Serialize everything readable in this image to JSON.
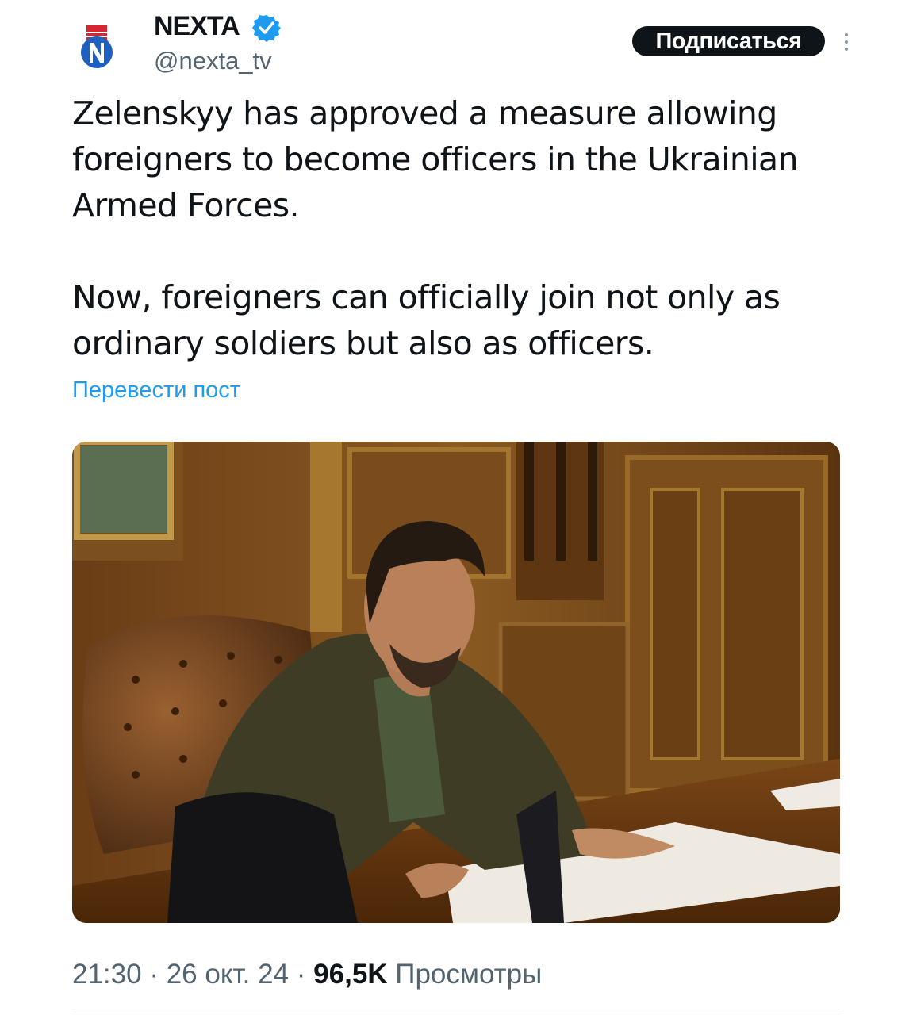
{
  "author": {
    "name": "NEXTA",
    "handle": "@nexta_tv",
    "verified": true,
    "avatar_icon": "nexta-logo-icon"
  },
  "actions": {
    "subscribe_label": "Подписаться",
    "more_icon": "more-vertical-icon"
  },
  "tweet": {
    "text": "Zelenskyy has approved a measure allowing\nforeigners to become officers in the Ukrainian\nArmed Forces.\n\nNow, foreigners can officially join not only as\nordinary soldiers but also as officers.",
    "translate_label": "Перевести пост"
  },
  "media": {
    "type": "photo"
  },
  "meta": {
    "time": "21:30",
    "separator": " · ",
    "date": "26 окт. 24",
    "views_count": "96,5K",
    "views_label": " Просмотры"
  },
  "colors": {
    "text": "#0f1419",
    "secondary": "#536471",
    "link": "#1d9bf0",
    "verified": "#1d9bf0",
    "button_bg": "#0f1419"
  }
}
